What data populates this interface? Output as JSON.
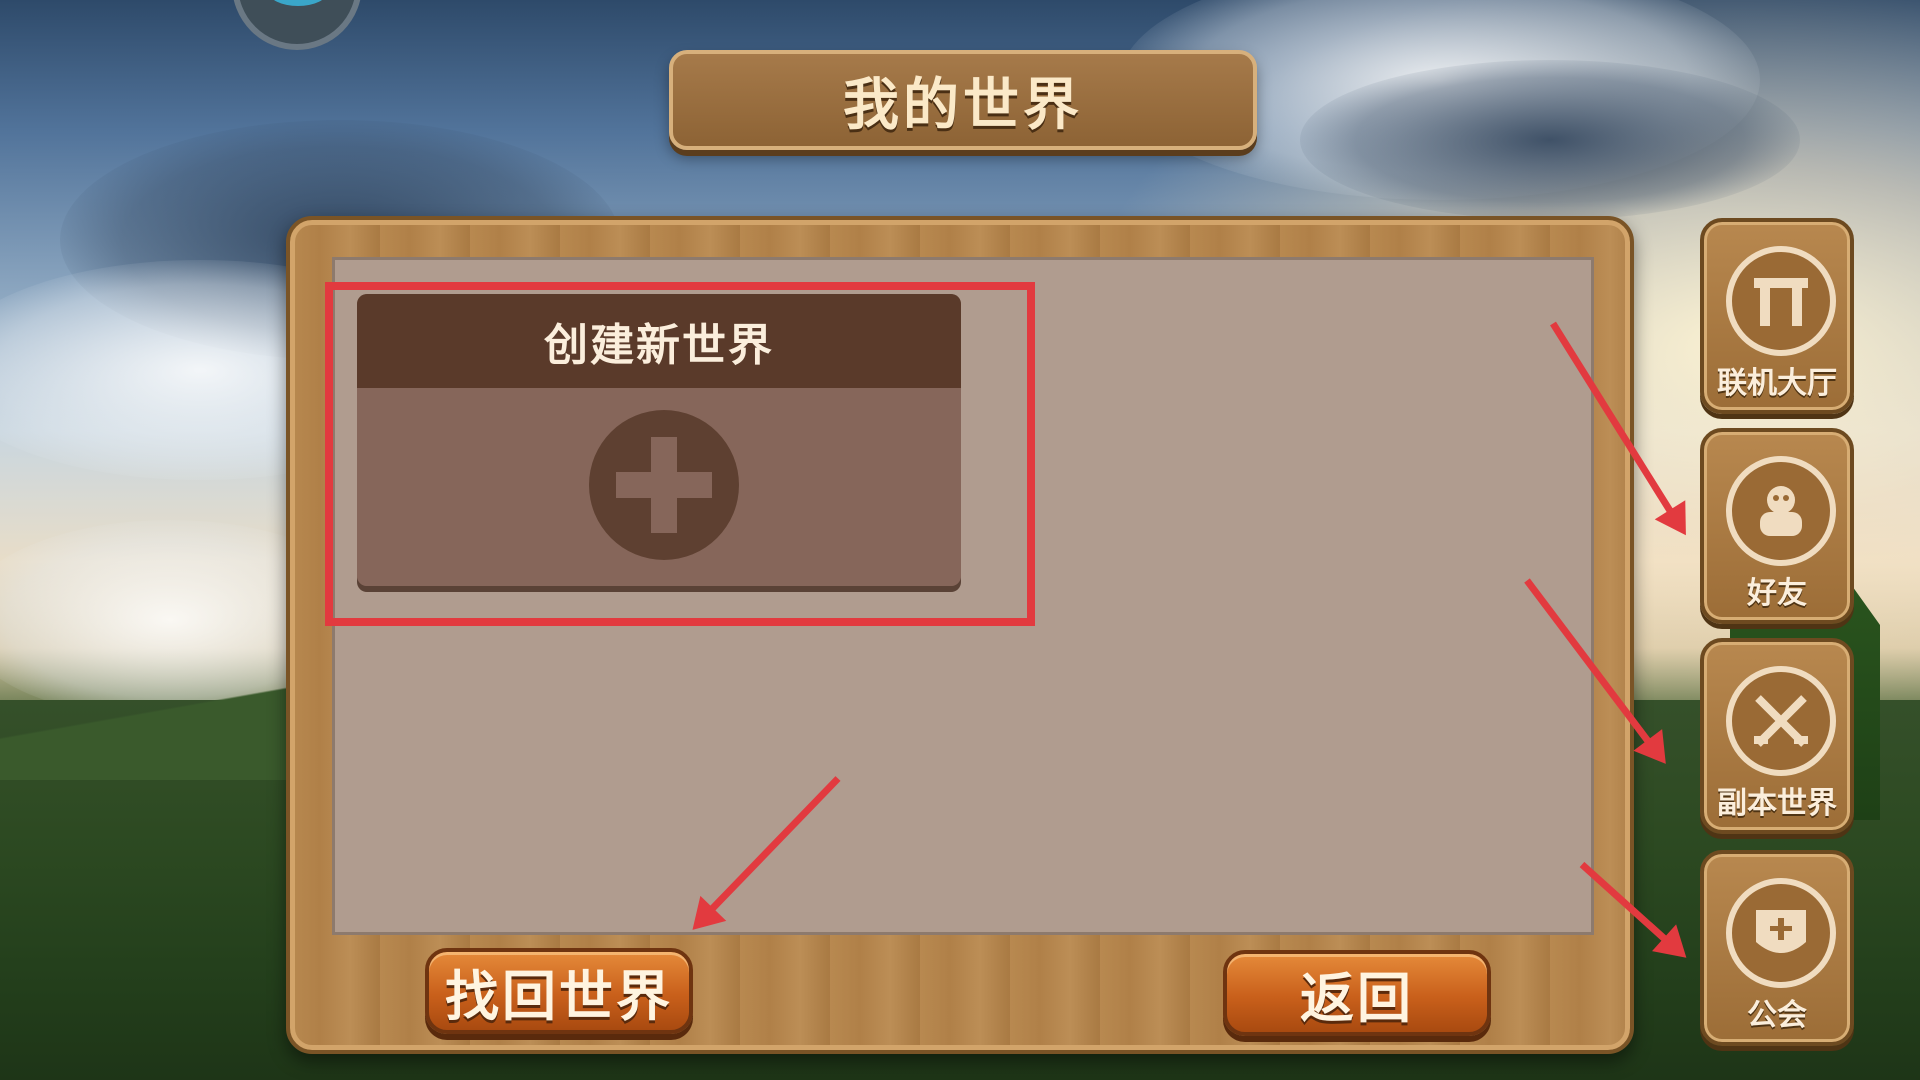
{
  "header": {
    "title": "我的世界"
  },
  "create_card": {
    "label": "创建新世界",
    "icon": "plus-icon"
  },
  "buttons": {
    "recover": "找回世界",
    "back": "返回"
  },
  "side_menu": [
    {
      "label": "联机大厅",
      "icon": "gate-icon"
    },
    {
      "label": "好友",
      "icon": "friend-icon"
    },
    {
      "label": "副本世界",
      "icon": "crossed-swords-icon"
    },
    {
      "label": "公会",
      "icon": "guild-banner-icon"
    }
  ],
  "colors": {
    "annotation": "#e23a3f",
    "button_orange": "#c9601b",
    "wood": "#b08048"
  }
}
